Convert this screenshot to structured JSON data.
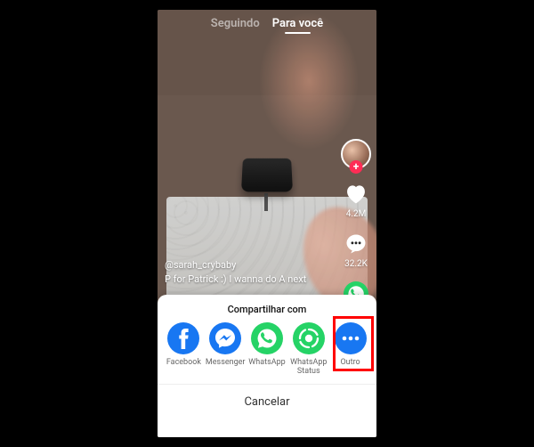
{
  "feed": {
    "tab_following": "Seguindo",
    "tab_for_you": "Para você"
  },
  "rail": {
    "likes_count": "4.2M",
    "comments_count": "32.2K"
  },
  "caption": {
    "user": "@sarah_crybaby",
    "text": "P for Patrick :) I wanna do A next"
  },
  "sheet": {
    "title": "Compartilhar com",
    "options": {
      "facebook": "Facebook",
      "messenger": "Messenger",
      "whatsapp": "WhatsApp",
      "whatsapp_status": "WhatsApp\nStatus",
      "other": "Outro"
    },
    "cancel": "Cancelar"
  },
  "colors": {
    "fb": "#1877F2",
    "wa": "#25D366",
    "other": "#1877F2",
    "tiktok_red": "#fe2c55"
  }
}
